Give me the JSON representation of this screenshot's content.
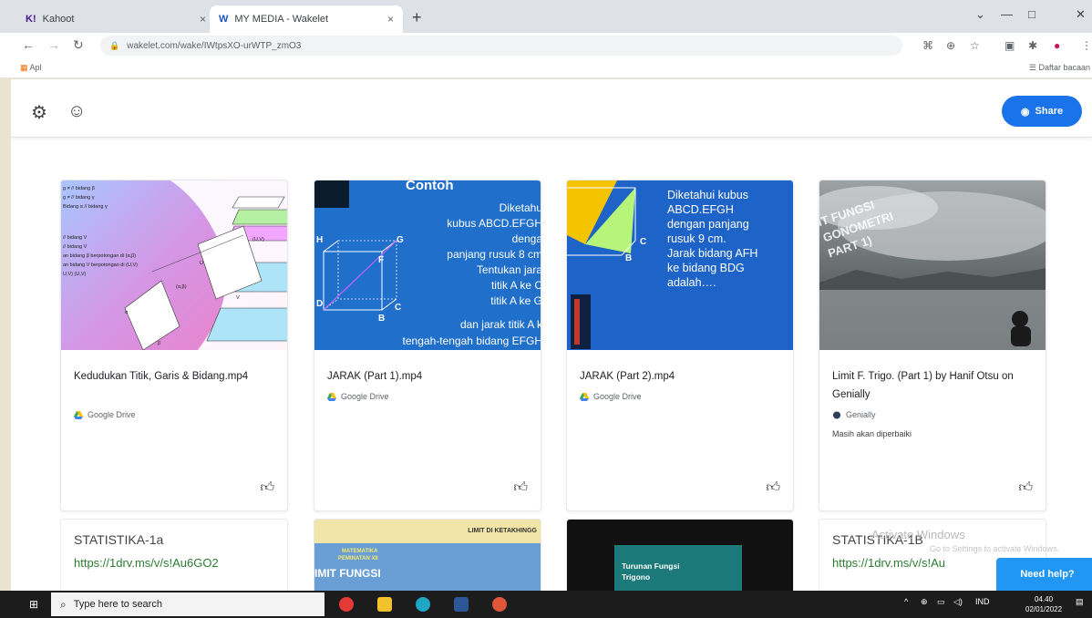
{
  "browser": {
    "tabs": [
      {
        "favicon": "K!",
        "title": "Kahoot",
        "close": "×"
      },
      {
        "favicon": "W",
        "title": "MY MEDIA - Wakelet",
        "close": "×"
      }
    ],
    "new_tab": "+",
    "window_controls": [
      "⌄",
      "—",
      "□",
      "✕"
    ],
    "url": "wakelet.com/wake/IWtpsXO-urWTP_zmO3",
    "bookmarks": {
      "apps": "Apl",
      "reading_list": "Daftar bacaan"
    }
  },
  "header": {
    "share_label": "Share"
  },
  "cards": [
    {
      "title": "Kedudukan Titik, Garis & Bidang.mp4",
      "source": "Google Drive",
      "thumb_labels": [
        "g ≠ // bidang β",
        "g ≠ // bidang γ",
        "Bidang α // bidang γ",
        "// bidang V",
        "// bidang V",
        "an bidang β berpotongan di (α,β)",
        "an bidang V berpotongan di (U,V)",
        "U,V) (U,V)",
        "(U,V)",
        "U",
        "V",
        "(α,β)",
        "α",
        "β"
      ]
    },
    {
      "title": "JARAK (Part 1).mp4",
      "source": "Google Drive",
      "thumb_lines": [
        "Contoh",
        "Diketahu",
        "kubus ABCD.EFGH",
        "denga",
        "panjang rusuk 8 cm",
        "Tentukan jara",
        "titik A ke C",
        "titik A ke G",
        "dan jarak titik A k",
        "tengah-tengah bidang EFGH"
      ],
      "cube_labels": [
        "H",
        "G",
        "F",
        "D",
        "C",
        "B"
      ]
    },
    {
      "title": "JARAK (Part 2).mp4",
      "source": "Google Drive",
      "thumb_lines": [
        "Diketahui kubus",
        "ABCD.EFGH",
        "dengan panjang",
        "rusuk 9 cm.",
        "Jarak bidang AFH",
        "ke bidang BDG",
        "adalah…."
      ],
      "cube_labels": [
        "C",
        "B"
      ]
    },
    {
      "title": "Limit F. Trigo. (Part 1) by Hanif Otsu on Genially",
      "source": "Genially",
      "note": "Masih akan diperbaiki",
      "thumb_lines": [
        "IT FUNGSI",
        "GONOMETRI",
        "PART 1)"
      ]
    }
  ],
  "row2": [
    {
      "title": "STATISTIKA-1a",
      "link": "https://1drv.ms/v/s!Au6GO2"
    },
    {
      "banner": "LIMIT DI KETAKHINGG",
      "sub1": "MATEMATIKA",
      "sub2": "PEMINATAN XII",
      "heading": "IMIT FUNGSI"
    },
    {
      "heading": "Turunan Fungsi",
      "sub": "Trigono"
    },
    {
      "title": "STATISTIKA-1B",
      "link": "https://1drv.ms/v/s!Au"
    }
  ],
  "watermark": {
    "line1": "Activate Windows",
    "line2": "Go to Settings to activate Windows."
  },
  "help_label": "Need help?",
  "taskbar": {
    "search_placeholder": "Type here to search",
    "lang": "IND",
    "time": "04.40",
    "date": "02/01/2022"
  },
  "colors": {
    "accent": "#1a73e8",
    "link": "#2e7d32",
    "taskbar": "#1c1c1c"
  }
}
